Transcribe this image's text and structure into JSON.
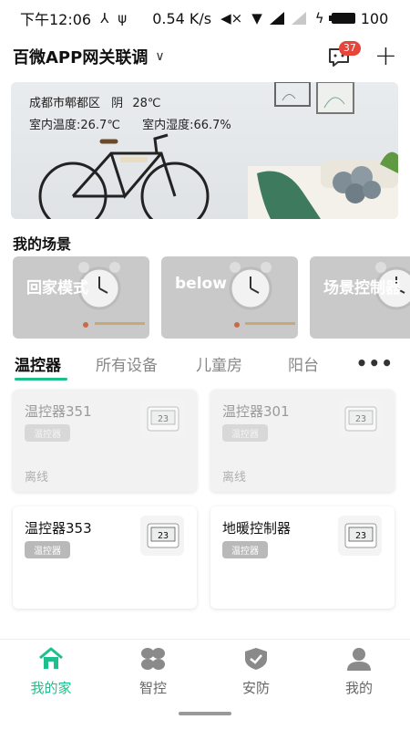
{
  "status_bar": {
    "time": "下午12:06",
    "speed": "0.54 K/s",
    "battery": "100"
  },
  "header": {
    "title": "百微APP网关联调",
    "message_count": "37"
  },
  "banner": {
    "location": "成都市郫都区",
    "weather": "阴",
    "outdoor_temp": "28℃",
    "indoor_temp": "室内温度:26.7℃",
    "indoor_humidity": "室内湿度:66.7%"
  },
  "scenes_section": {
    "title": "我的场景",
    "items": [
      {
        "label": "回家模式"
      },
      {
        "label": "below"
      },
      {
        "label": "场景控制器"
      }
    ]
  },
  "tabs": {
    "items": [
      "温控器",
      "所有设备",
      "儿童房",
      "阳台"
    ],
    "active": "温控器",
    "more": "•••"
  },
  "devices": [
    {
      "name": "温控器351",
      "tag": "温控器",
      "status": "离线",
      "display": "23"
    },
    {
      "name": "温控器301",
      "tag": "温控器",
      "status": "离线",
      "display": "23"
    },
    {
      "name": "温控器353",
      "tag": "温控器",
      "status": "",
      "display": "23"
    },
    {
      "name": "地暖控制器",
      "tag": "温控器",
      "status": "",
      "display": "23"
    }
  ],
  "bottom_nav": [
    {
      "label": "我的家",
      "icon": "home-icon",
      "active": true
    },
    {
      "label": "智控",
      "icon": "grid-icon",
      "active": false
    },
    {
      "label": "安防",
      "icon": "shield-icon",
      "active": false
    },
    {
      "label": "我的",
      "icon": "person-icon",
      "active": false
    }
  ],
  "colors": {
    "accent": "#1dbf8c",
    "badge": "#e5453b"
  }
}
